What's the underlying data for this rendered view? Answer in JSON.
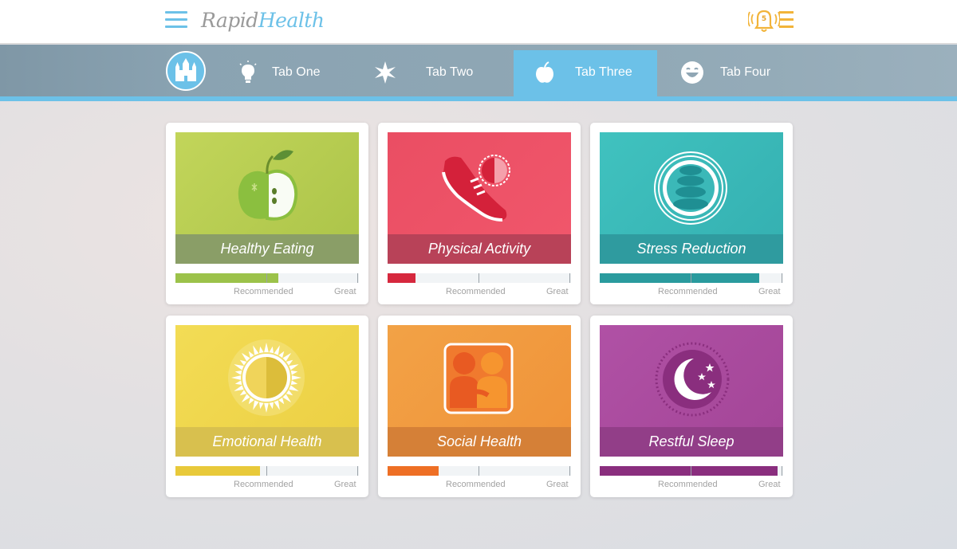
{
  "app": {
    "brand_part1": "Rapid",
    "brand_part2": "Health",
    "notification_count": "5",
    "accent_color": "#6cc1e8",
    "alert_color": "#f2b43a"
  },
  "header": {
    "left_menu_icon": "hamburger-menu-icon",
    "right_icons": [
      "bell-alert-icon",
      "list-menu-icon"
    ]
  },
  "tabs": [
    {
      "label": "Tab One",
      "icon": "lightbulb-icon",
      "active": false
    },
    {
      "label": "Tab Two",
      "icon": "star-burst-icon",
      "active": false
    },
    {
      "label": "Tab Three",
      "icon": "apple-icon",
      "active": true
    },
    {
      "label": "Tab Four",
      "icon": "smiley-face-icon",
      "active": false
    }
  ],
  "home_icon": "castle-icon",
  "scale_labels": {
    "recommended": "Recommended",
    "great": "Great"
  },
  "cards": [
    {
      "title": "Healthy Eating",
      "icon": "apple-icon",
      "color": "#b7cc4f",
      "bar_color": "#9cc24a",
      "progress": 0.56
    },
    {
      "title": "Physical Activity",
      "icon": "sneaker-icon",
      "color": "#e8495f",
      "bar_color": "#d6283e",
      "progress": 0.15
    },
    {
      "title": "Stress Reduction",
      "icon": "stacked-stones-icon",
      "color": "#3bb8b8",
      "bar_color": "#2a9b9e",
      "progress": 0.87
    },
    {
      "title": "Emotional Health",
      "icon": "sun-icon",
      "color": "#f0d64a",
      "bar_color": "#e8c93a",
      "progress": 0.46
    },
    {
      "title": "Social Health",
      "icon": "two-people-icon",
      "color": "#f29c3d",
      "bar_color": "#ee6f25",
      "progress": 0.28
    },
    {
      "title": "Restful Sleep",
      "icon": "moon-and-stars-icon",
      "color": "#a84b9e",
      "bar_color": "#8a2e7e",
      "progress": 0.97
    }
  ]
}
